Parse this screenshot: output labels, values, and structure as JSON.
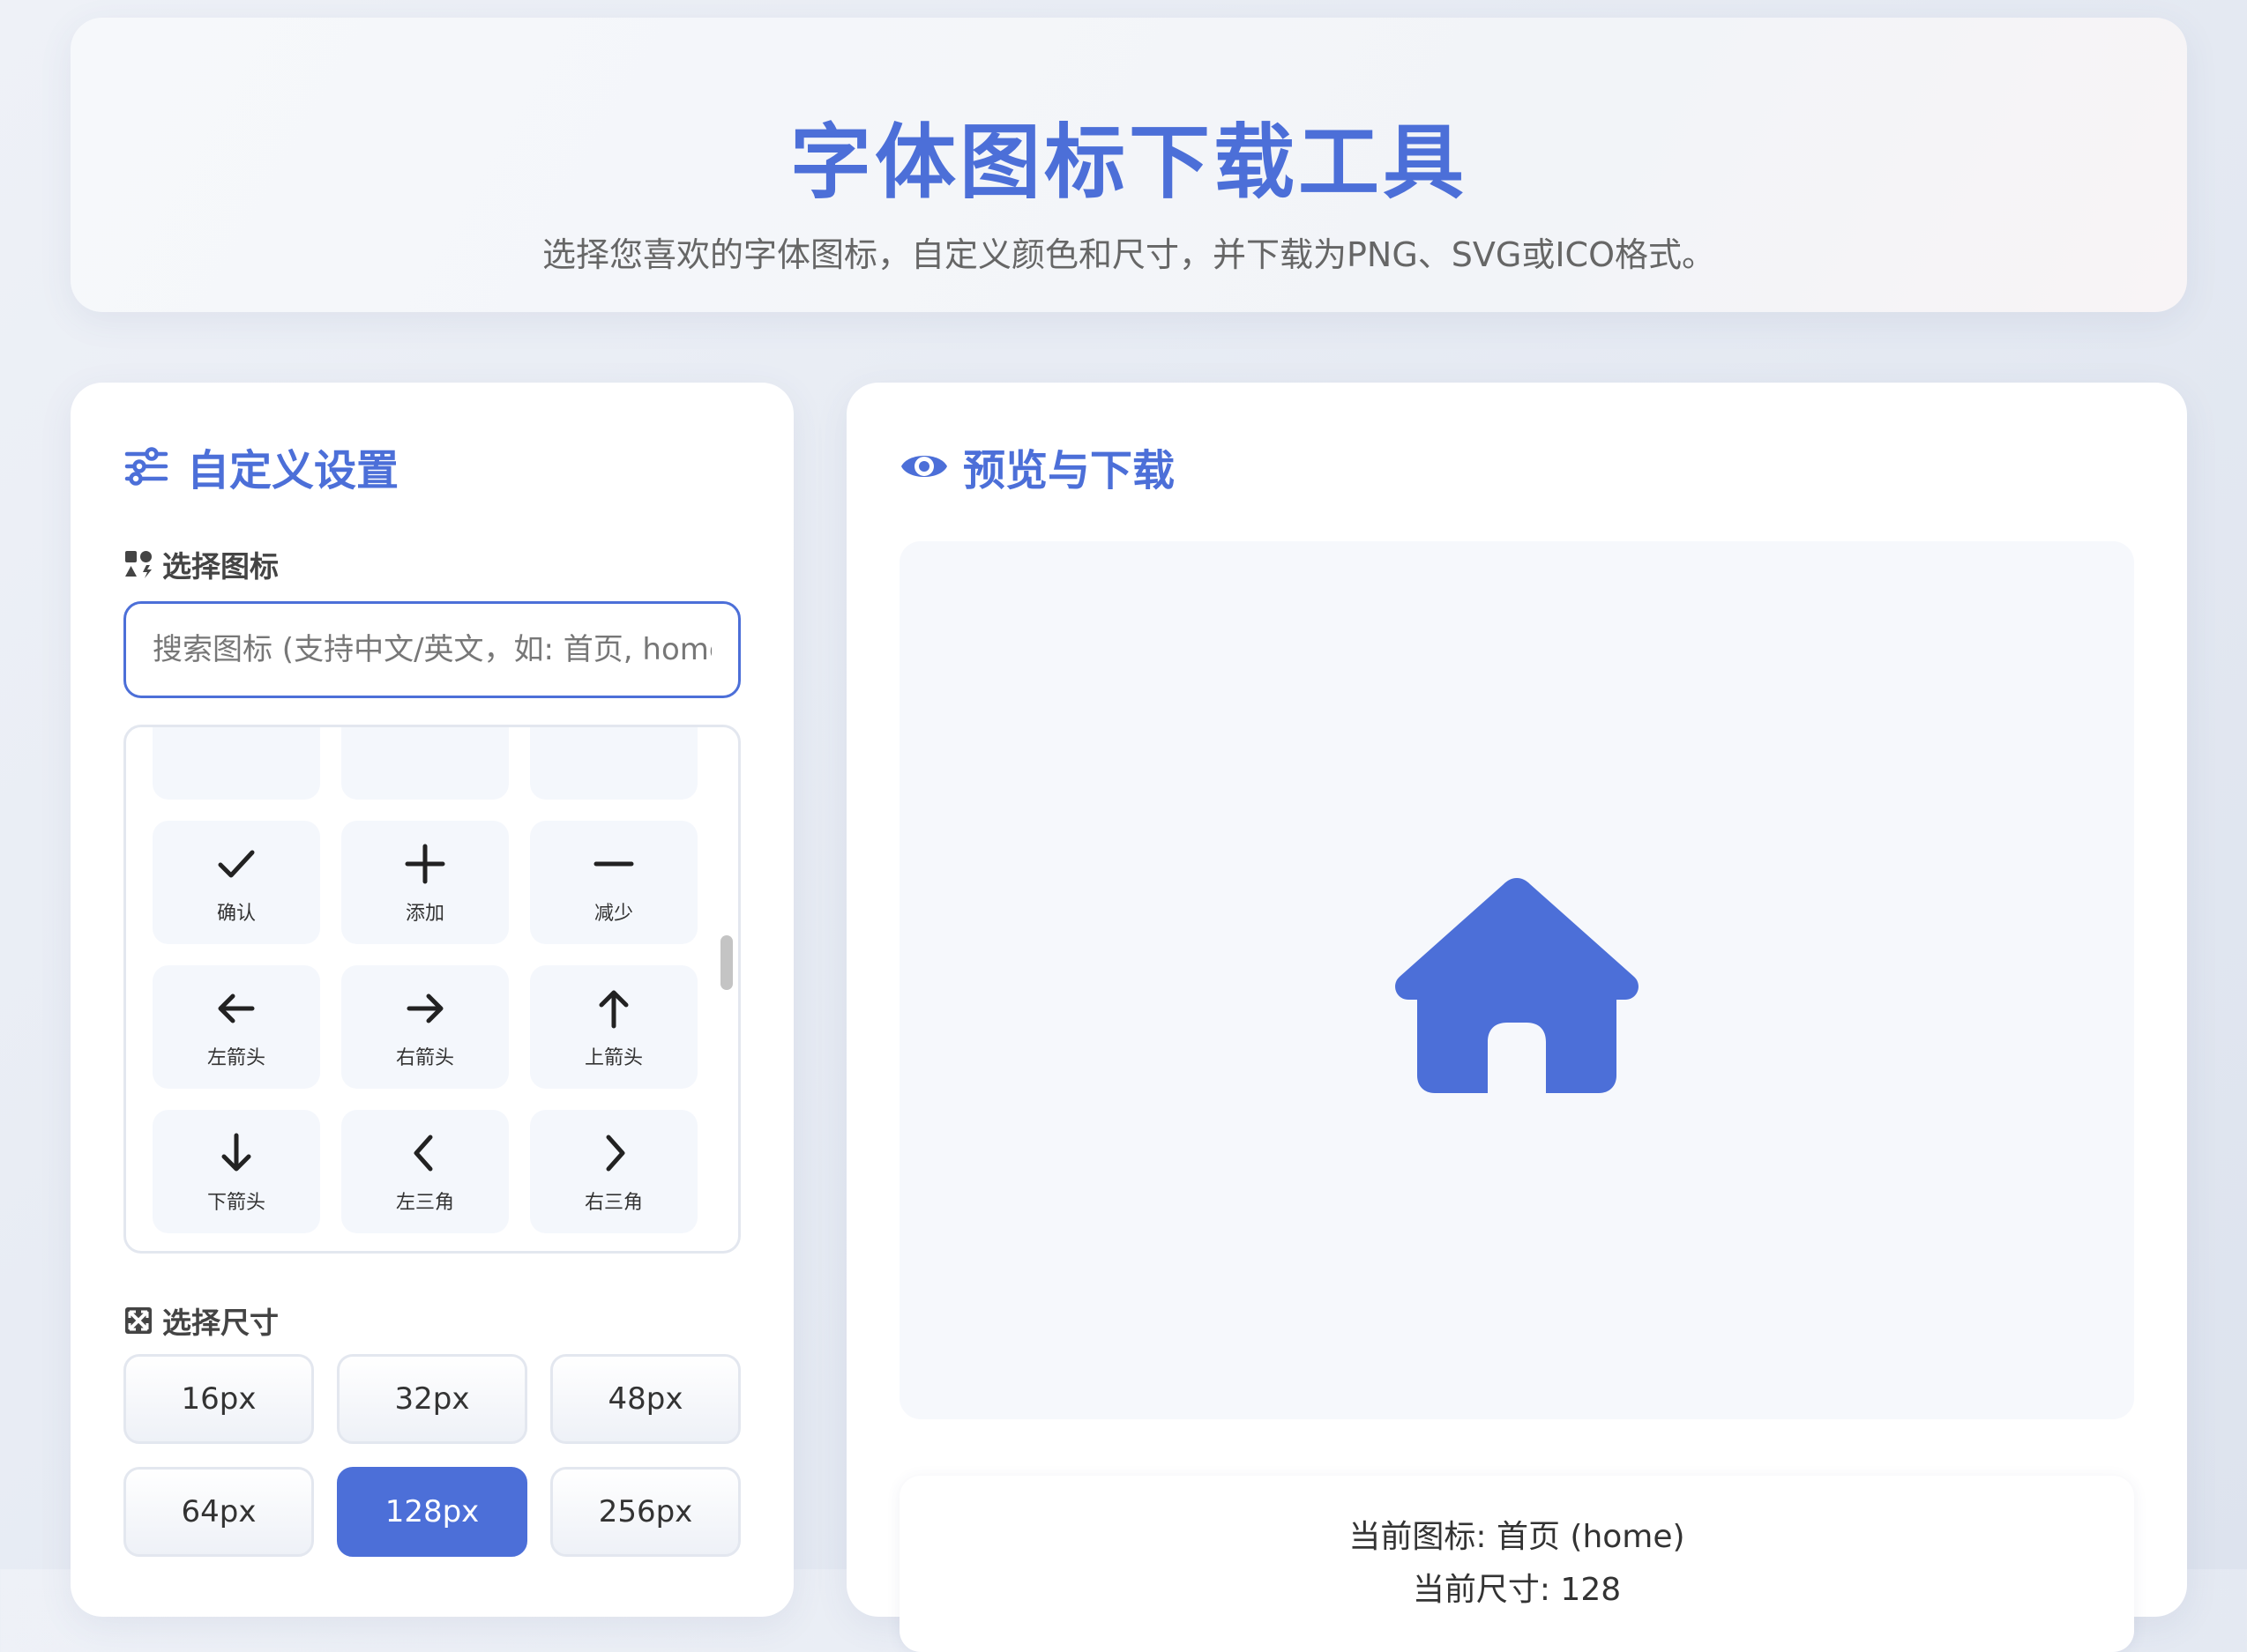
{
  "header": {
    "title": "字体图标下载工具",
    "subtitle": "选择您喜欢的字体图标，自定义颜色和尺寸，并下载为PNG、SVG或ICO格式。"
  },
  "left_panel": {
    "title": "自定义设置",
    "title_icon": "sliders-icon",
    "icon_section_label": "选择图标",
    "icon_section_icon": "icons-icon",
    "search": {
      "placeholder": "搜索图标 (支持中文/英文，如: 首页, home, u",
      "value": ""
    },
    "icons": [
      {
        "name": "top-partial-1",
        "label": ""
      },
      {
        "name": "top-partial-2",
        "label": ""
      },
      {
        "name": "top-partial-3",
        "label": ""
      },
      {
        "name": "check-icon",
        "label": "确认"
      },
      {
        "name": "plus-icon",
        "label": "添加"
      },
      {
        "name": "minus-icon",
        "label": "减少"
      },
      {
        "name": "arrow-left-icon",
        "label": "左箭头"
      },
      {
        "name": "arrow-right-icon",
        "label": "右箭头"
      },
      {
        "name": "arrow-up-icon",
        "label": "上箭头"
      },
      {
        "name": "arrow-down-icon",
        "label": "下箭头"
      },
      {
        "name": "chevron-left-icon",
        "label": "左三角"
      },
      {
        "name": "chevron-right-icon",
        "label": "右三角"
      },
      {
        "name": "chevron-up-icon",
        "label": ""
      },
      {
        "name": "chevron-down-icon",
        "label": ""
      },
      {
        "name": "square-x-icon",
        "label": ""
      }
    ],
    "size_section_label": "选择尺寸",
    "size_section_icon": "expand-icon",
    "sizes": [
      "16px",
      "32px",
      "48px",
      "64px",
      "128px",
      "256px"
    ],
    "selected_size": "128px"
  },
  "right_panel": {
    "title": "预览与下载",
    "title_icon": "eye-icon",
    "preview_icon": "home-icon",
    "preview_color": "#4c6fd8",
    "current_icon_text": "当前图标: 首页 (home)",
    "current_size_text": "当前尺寸: 128"
  },
  "colors": {
    "accent": "#4c6fd8"
  }
}
